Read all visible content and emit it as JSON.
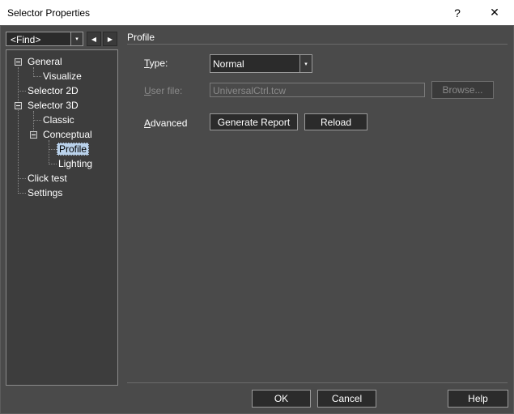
{
  "window": {
    "title": "Selector Properties",
    "help_glyph": "?",
    "close_glyph": "✕"
  },
  "find": {
    "value": "<Find>",
    "dropdown_glyph": "▾",
    "back_glyph": "◀",
    "forward_glyph": "▶"
  },
  "tree": {
    "items": [
      {
        "label": "General"
      },
      {
        "label": "Visualize"
      },
      {
        "label": "Selector 2D"
      },
      {
        "label": "Selector 3D"
      },
      {
        "label": "Classic"
      },
      {
        "label": "Conceptual"
      },
      {
        "label": "Profile"
      },
      {
        "label": "Lighting"
      },
      {
        "label": "Click test"
      },
      {
        "label": "Settings"
      }
    ],
    "selected": "Profile"
  },
  "panel": {
    "title": "Profile",
    "type_label_first": "T",
    "type_label_rest": "ype:",
    "type_value": "Normal",
    "userfile_label_first": "U",
    "userfile_label_rest": "ser file:",
    "userfile_value": "UniversalCtrl.tcw",
    "browse_label": "Browse...",
    "advanced_label_first": "A",
    "advanced_label_rest": "dvanced",
    "generate_report_label": "Generate Report",
    "reload_label": "Reload"
  },
  "footer": {
    "ok_label": "OK",
    "cancel_label": "Cancel",
    "help_label": "Help"
  }
}
